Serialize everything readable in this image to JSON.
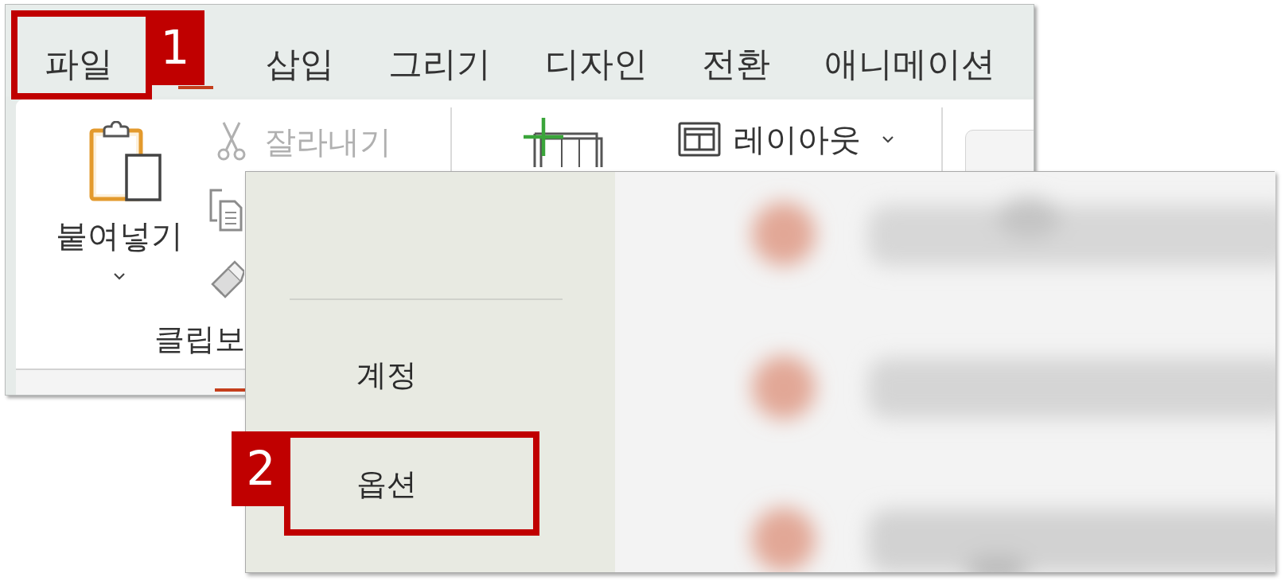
{
  "ribbon_window": {
    "tabs": [
      {
        "label": "파일",
        "selected": false,
        "callout": "1"
      },
      {
        "selected": true
      },
      {
        "label": "삽입",
        "selected": false
      },
      {
        "label": "그리기",
        "selected": false
      },
      {
        "label": "디자인",
        "selected": false
      },
      {
        "label": "전환",
        "selected": false
      },
      {
        "label": "애니메이션",
        "selected": false
      }
    ],
    "clipboard_group": {
      "paste": {
        "label": "붙여넣기"
      },
      "cut": {
        "label": "잘라내기",
        "disabled": true
      },
      "group_label": "클립보"
    },
    "slides_group": {
      "layout": {
        "label": "레이아웃"
      }
    }
  },
  "file_menu": {
    "items": [
      {
        "label": "계정",
        "selected": false
      },
      {
        "label": "옵션",
        "selected": false,
        "callout": "2"
      }
    ]
  }
}
